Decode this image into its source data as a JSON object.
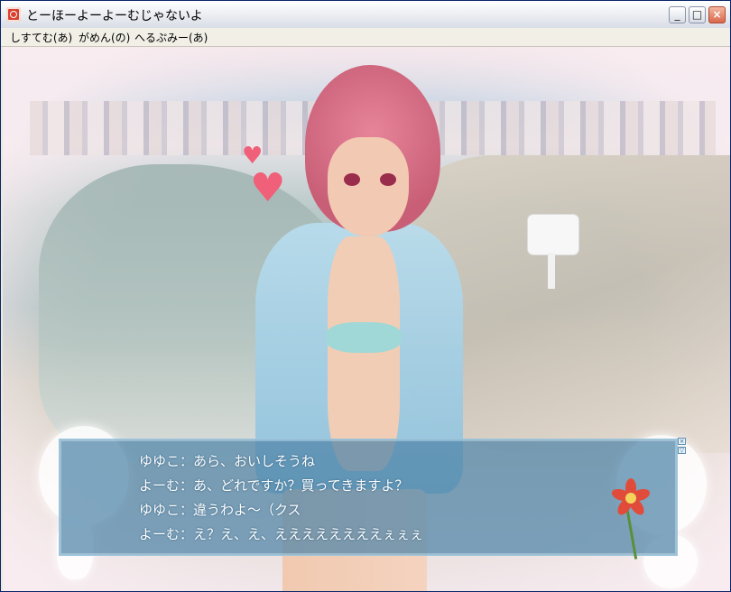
{
  "window": {
    "title": "とーほーよーよーむじゃないよ",
    "controls": {
      "minimize": "_",
      "maximize": "□",
      "close": "×"
    }
  },
  "menubar": {
    "items": [
      {
        "label": "しすてむ(あ)"
      },
      {
        "label": "がめん(の)"
      },
      {
        "label": "へるぷみー(あ)"
      }
    ]
  },
  "dialog": {
    "lines": [
      {
        "text": "ゆゆこ：あら、おいしそうね"
      },
      {
        "text": "よーむ：あ、どれですか？買ってきますよ？"
      },
      {
        "text": "ゆゆこ：違うわよ～（クス"
      },
      {
        "text": "よーむ：え？え、え、ええええええええぇぇぇ"
      }
    ],
    "controls": {
      "close": "×",
      "scroll": "▽"
    }
  },
  "colors": {
    "dialog_bg": "#4e83a8",
    "title_bar": "#eef0f4",
    "close_button": "#d9674b"
  }
}
